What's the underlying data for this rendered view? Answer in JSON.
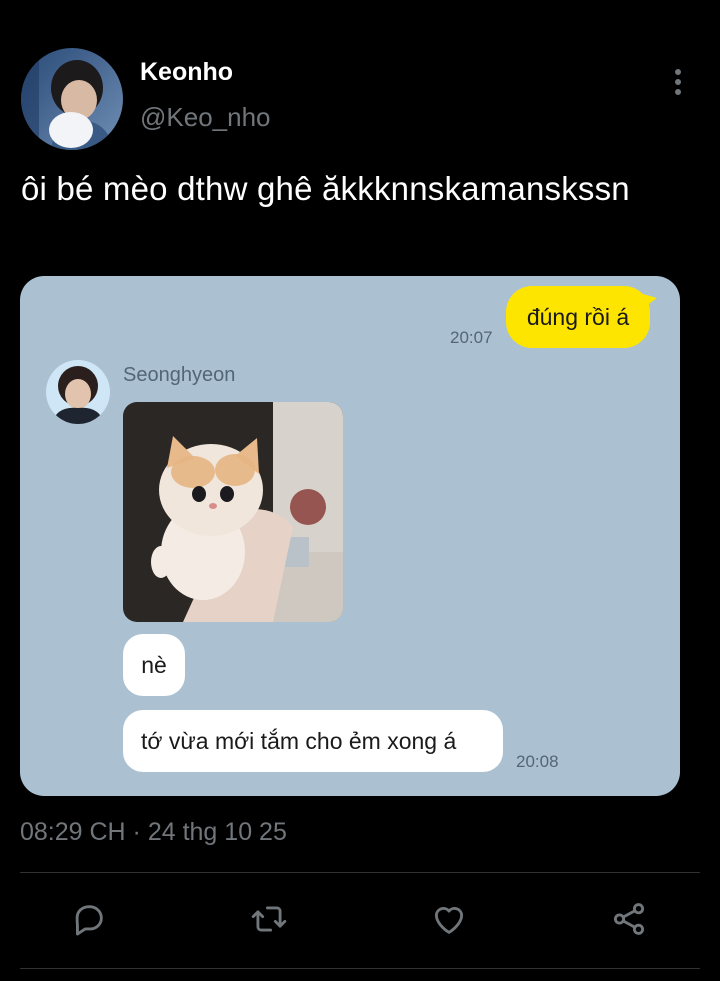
{
  "tweet": {
    "display_name": "Keonho",
    "handle": "@Keo_nho",
    "text": "ôi bé mèo dthw ghê ăkkknnskamanskssn",
    "timestamp": "08:29 CH · 24 thg 10 25"
  },
  "chat": {
    "sent_message": "đúng rồi á",
    "sent_time": "20:07",
    "sender_name": "Seonghyeon",
    "messages": [
      "nè",
      "tớ vừa mới tắm cho ẻm xong á"
    ],
    "received_time": "20:08"
  },
  "actions": [
    {
      "icon": "reply-icon"
    },
    {
      "icon": "retweet-icon"
    },
    {
      "icon": "like-icon"
    },
    {
      "icon": "share-icon"
    }
  ],
  "colors": {
    "background": "#000000",
    "chat_background": "#abc1d1",
    "sent_bubble": "#fee500",
    "received_bubble": "#ffffff",
    "secondary_text": "#71767b"
  }
}
